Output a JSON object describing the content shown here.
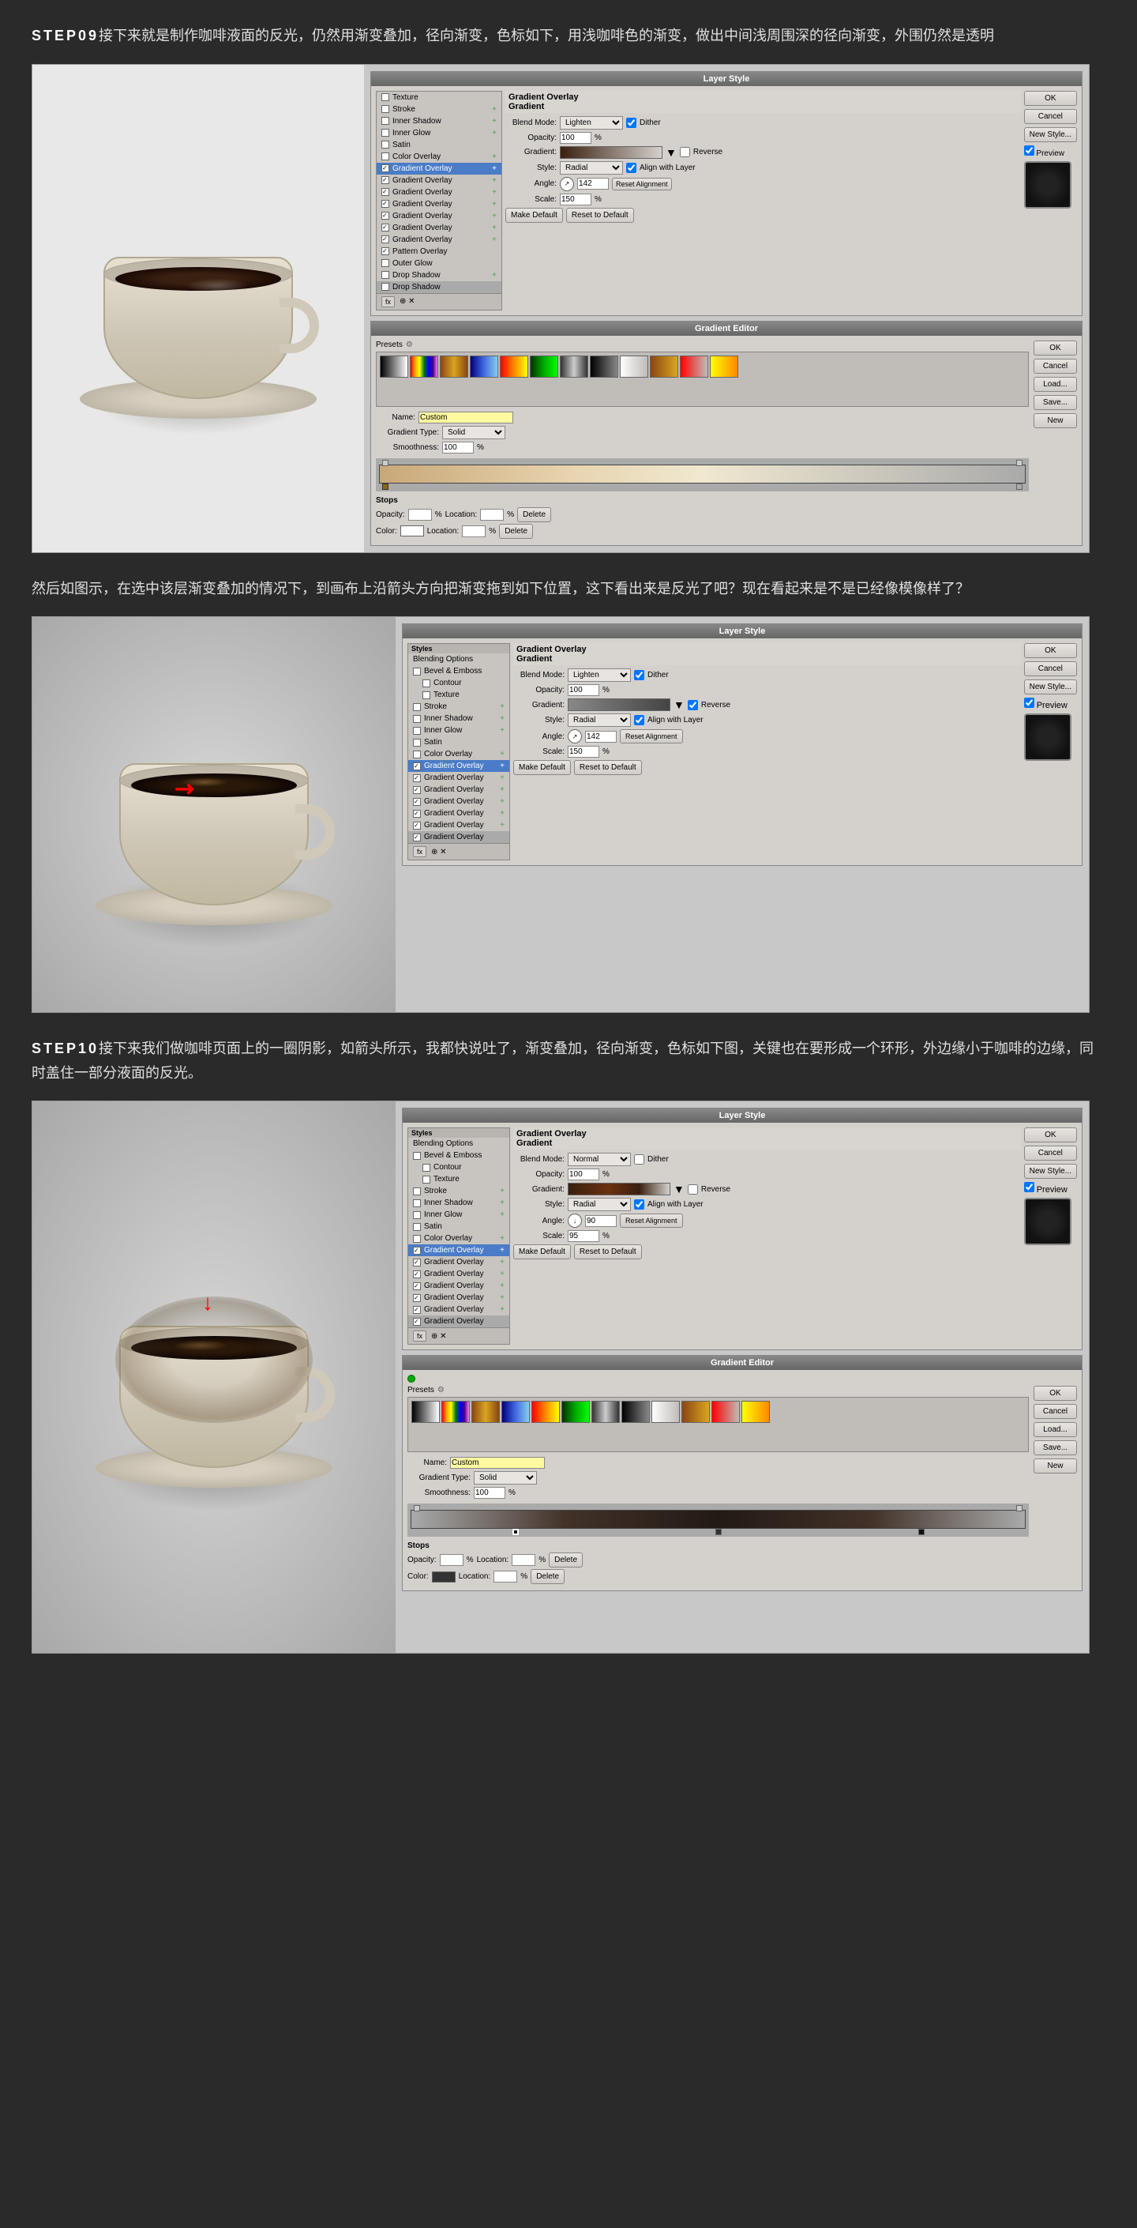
{
  "page": {
    "background": "#2a2a2a"
  },
  "step9": {
    "label": "STEP09",
    "text": "接下来就是制作咖啡液面的反光，仍然用渐变叠加，径向渐变，色标如下，用浅咖啡色的渐变，做出中间浅周围深的径向渐变，外围仍然是透明"
  },
  "step9b_text": "然后如图示，在选中该层渐变叠加的情况下，到画布上沿箭头方向把渐变拖到如下位置，这下看出来是反光了吧？现在看起来是不是已经像模像样了？",
  "step10": {
    "label": "STEP10",
    "text": "接下来我们做咖啡页面上的一圈阴影，如箭头所示，我都快说吐了，渐变叠加，径向渐变，色标如下图，关键也在要形成一个环形，外边缘小于咖啡的边缘，同时盖住一部分液面的反光。"
  },
  "layer_style": {
    "title": "Layer Style",
    "section_title": "Gradient Overlay",
    "sub_title": "Gradient",
    "blend_mode_label": "Blend Mode:",
    "blend_mode_value1": "Lighten",
    "blend_mode_value2": "Normal",
    "dither_label": "Dither",
    "opacity_label": "Opacity:",
    "opacity_value": "100",
    "percent": "%",
    "gradient_label": "Gradient:",
    "reverse_label": "Reverse",
    "style_label": "Style:",
    "style_value": "Radial",
    "align_label": "Align with Layer",
    "angle_label": "Angle:",
    "angle_value1": "142",
    "angle_value2": "90",
    "reset_alignment": "Reset Alignment",
    "scale_label": "Scale:",
    "scale_value1": "150",
    "scale_value2": "95",
    "make_default": "Make Default",
    "reset_to_default": "Reset to Default"
  },
  "buttons": {
    "ok": "OK",
    "cancel": "Cancel",
    "new_style": "New Style...",
    "preview": "Preview",
    "load": "Load...",
    "save": "Save...",
    "new": "New",
    "delete": "Delete"
  },
  "gradient_editor": {
    "title": "Gradient Editor",
    "presets_label": "Presets",
    "name_label": "Name:",
    "name_value": "Custom",
    "gradient_type_label": "Gradient Type:",
    "gradient_type_value": "Solid",
    "smoothness_label": "Smoothness:",
    "smoothness_value": "100",
    "percent": "%",
    "stops_title": "Stops",
    "opacity_label": "Opacity:",
    "location_label": "Location:",
    "color_label": "Color:"
  },
  "layer_list_1": {
    "items": [
      {
        "label": "Texture",
        "checked": false,
        "active": false
      },
      {
        "label": "Stroke",
        "checked": false,
        "active": false,
        "has_plus": true
      },
      {
        "label": "Inner Shadow",
        "checked": false,
        "active": false,
        "has_plus": true
      },
      {
        "label": "Inner Glow",
        "checked": false,
        "active": false,
        "has_plus": true
      },
      {
        "label": "Satin",
        "checked": false,
        "active": false
      },
      {
        "label": "Color Overlay",
        "checked": false,
        "active": false,
        "has_plus": true
      },
      {
        "label": "Gradient Overlay",
        "checked": true,
        "active": true,
        "has_plus": true
      },
      {
        "label": "Gradient Overlay",
        "checked": true,
        "active": false,
        "has_plus": true
      },
      {
        "label": "Gradient Overlay",
        "checked": true,
        "active": false,
        "has_plus": true
      },
      {
        "label": "Gradient Overlay",
        "checked": true,
        "active": false,
        "has_plus": true
      },
      {
        "label": "Gradient Overlay",
        "checked": true,
        "active": false,
        "has_plus": true
      },
      {
        "label": "Gradient Overlay",
        "checked": true,
        "active": false,
        "has_plus": true
      },
      {
        "label": "Gradient Overlay",
        "checked": true,
        "active": false,
        "has_plus": true
      },
      {
        "label": "Pattern Overlay",
        "checked": true,
        "active": false,
        "has_plus": false
      },
      {
        "label": "Outer Glow",
        "checked": false,
        "active": false
      },
      {
        "label": "Drop Shadow",
        "checked": false,
        "active": false,
        "has_plus": true
      },
      {
        "label": "Drop Shadow",
        "checked": false,
        "active": false
      }
    ]
  },
  "layer_list_2": {
    "items": [
      {
        "label": "Styles",
        "is_header": true
      },
      {
        "label": "Blending Options",
        "checked": false,
        "active": false
      },
      {
        "label": "Bevel & Emboss",
        "checked": false
      },
      {
        "label": "Contour",
        "checked": false
      },
      {
        "label": "Texture",
        "checked": false
      },
      {
        "label": "Stroke",
        "checked": false,
        "has_plus": true
      },
      {
        "label": "Inner Shadow",
        "checked": false,
        "has_plus": true
      },
      {
        "label": "Inner Glow",
        "checked": false,
        "has_plus": true
      },
      {
        "label": "Satin",
        "checked": false
      },
      {
        "label": "Color Overlay",
        "checked": false,
        "has_plus": true
      },
      {
        "label": "Gradient Overlay",
        "checked": true,
        "active": true,
        "has_plus": true
      },
      {
        "label": "Gradient Overlay",
        "checked": true,
        "has_plus": true
      },
      {
        "label": "Gradient Overlay",
        "checked": true,
        "has_plus": true
      },
      {
        "label": "Gradient Overlay",
        "checked": true,
        "has_plus": true
      },
      {
        "label": "Gradient Overlay",
        "checked": true,
        "has_plus": true
      },
      {
        "label": "Gradient Overlay",
        "checked": true,
        "has_plus": true
      },
      {
        "label": "Gradient Overlay",
        "checked": true,
        "has_plus": true
      }
    ]
  }
}
